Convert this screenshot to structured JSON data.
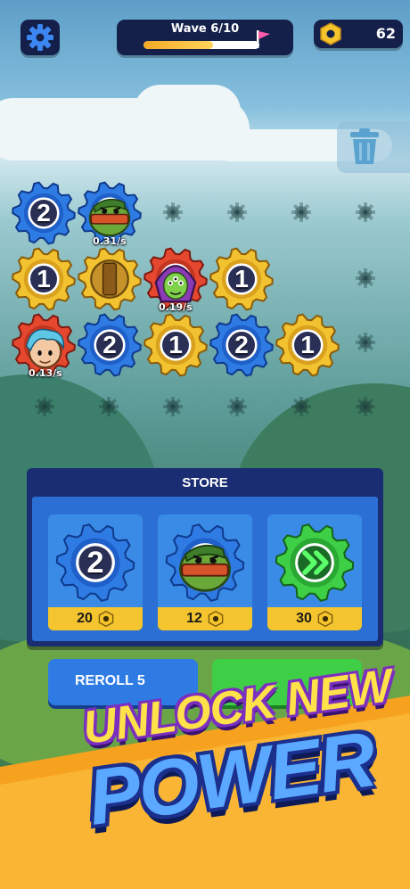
{
  "hud": {
    "settings_icon": "gear-icon",
    "wave_label": "Wave 6/10",
    "wave_progress": 0.6,
    "flag_icon": "flag-icon",
    "coin_icon": "hex-nut-coin-icon",
    "coins": "62",
    "trash_icon": "trash-icon"
  },
  "board": {
    "units": [
      {
        "label": "2",
        "color": "blue"
      },
      {
        "label": "",
        "color": "blue",
        "character": "green-ninja",
        "rate": "0.31/s"
      },
      {
        "label": "1",
        "color": "yellow"
      },
      {
        "label": "",
        "color": "yellow",
        "character": "brown-block"
      },
      {
        "label": "",
        "color": "red",
        "character": "purple-cyclops",
        "rate": "0.19/s"
      },
      {
        "label": "1",
        "color": "yellow"
      },
      {
        "label": "",
        "color": "red",
        "character": "blue-hair-hero",
        "rate": "0.13/s"
      },
      {
        "label": "2",
        "color": "blue"
      },
      {
        "label": "1",
        "color": "yellow"
      },
      {
        "label": "2",
        "color": "blue"
      },
      {
        "label": "1",
        "color": "yellow"
      }
    ]
  },
  "store": {
    "title": "STORE",
    "items": [
      {
        "label": "2",
        "price": "20",
        "color": "blue"
      },
      {
        "label": "",
        "price": "12",
        "color": "blue",
        "character": "green-ninja"
      },
      {
        "label": "",
        "price": "30",
        "color": "green",
        "icon": "fast-forward-icon"
      }
    ]
  },
  "buttons": {
    "reroll_label": "REROLL 5"
  },
  "promo": {
    "line1": "UNLOCK NEW",
    "line2": "POWER"
  },
  "colors": {
    "blue_gear": "#2f7be4",
    "yellow_gear": "#f2c230",
    "red_gear": "#e5482e",
    "green_gear": "#3fcf47",
    "hud_dark": "#14204a",
    "banner_orange": "#f6a21e"
  }
}
